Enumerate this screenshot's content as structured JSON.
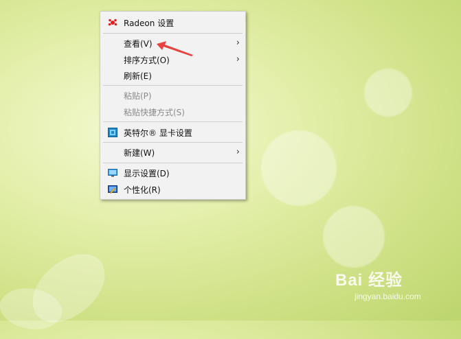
{
  "menu": {
    "radeon": {
      "label": "Radeon 设置",
      "icon": "radeon-icon"
    },
    "view": {
      "label": "查看(V)",
      "has_submenu": true
    },
    "sort": {
      "label": "排序方式(O)",
      "has_submenu": true
    },
    "refresh": {
      "label": "刷新(E)"
    },
    "paste": {
      "label": "粘贴(P)",
      "disabled": true
    },
    "paste_shortcut": {
      "label": "粘贴快捷方式(S)",
      "disabled": true
    },
    "intel": {
      "label": "英特尔® 显卡设置",
      "icon": "intel-graphics-icon"
    },
    "new": {
      "label": "新建(W)",
      "has_submenu": true
    },
    "display": {
      "label": "显示设置(D)",
      "icon": "display-settings-icon"
    },
    "personalize": {
      "label": "个性化(R)",
      "icon": "personalize-icon"
    }
  },
  "watermark": {
    "brand": "Bai 经验",
    "url": "jingyan.baidu.com"
  },
  "colors": {
    "menu_bg": "#f2f2f2",
    "arrow": "#e8423f",
    "disabled_text": "#8a8a8a"
  }
}
